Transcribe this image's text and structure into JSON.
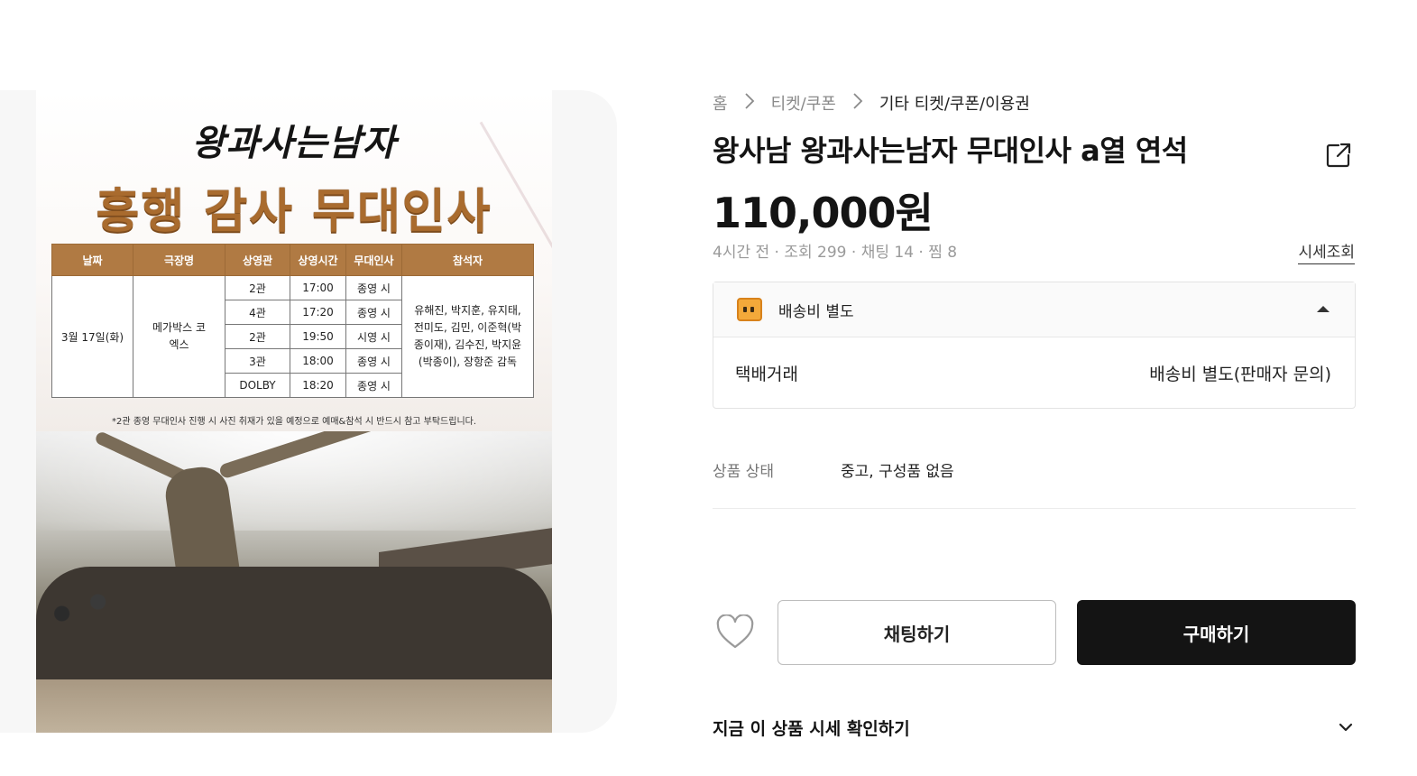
{
  "poster": {
    "logo_text": "왕과사는남자",
    "headline": "흥행 감사 무대인사",
    "table_headers": [
      "날짜",
      "극장명",
      "상영관",
      "상영시간",
      "무대인사",
      "참석자"
    ],
    "date": "3월 17일(화)",
    "theater": "메가박스 코엑스",
    "rows": [
      {
        "hall": "2관",
        "time": "17:00",
        "greeting": "종영 시"
      },
      {
        "hall": "4관",
        "time": "17:20",
        "greeting": "종영 시"
      },
      {
        "hall": "2관",
        "time": "19:50",
        "greeting": "시영 시"
      },
      {
        "hall": "3관",
        "time": "18:00",
        "greeting": "종영 시"
      },
      {
        "hall": "DOLBY",
        "time": "18:20",
        "greeting": "종영 시"
      }
    ],
    "attendees": "유해진, 박지훈, 유지태, 전미도, 김민, 이준혁(박종이재), 김수진, 박지윤(박종이), 장항준 감독",
    "note": "*2관 종영 무대인사 진행 시 사진 취재가 있을 예정으로 예매&참석 시 반드시 참고 부탁드립니다."
  },
  "breadcrumb": {
    "home": "홈",
    "category": "티켓/쿠폰",
    "current": "기타 티켓/쿠폰/이용권"
  },
  "product": {
    "title": "왕사남 왕과사는남자 무대인사 a열 연석",
    "price": "110,000원",
    "meta": "4시간 전 · 조회 299 · 채팅 14 · 찜 8",
    "market_link": "시세조회"
  },
  "shipping": {
    "title": "배송비 별도",
    "method": "택배거래",
    "fee": "배송비 별도(판매자 문의)"
  },
  "condition": {
    "label": "상품 상태",
    "value": "중고, 구성품 없음"
  },
  "actions": {
    "chat": "채팅하기",
    "buy": "구매하기"
  },
  "accordion": {
    "label": "지금 이 상품 시세 확인하기"
  },
  "icons": {
    "share": "share-icon",
    "box": "box-icon",
    "caret": "chevron-up-icon",
    "heart": "heart-icon",
    "accordion": "chevron-down-icon"
  },
  "colors": {
    "primary_button": "#141414",
    "text": "#141414",
    "muted": "#9a9a9a",
    "poster_gold": "#a96b2e"
  }
}
